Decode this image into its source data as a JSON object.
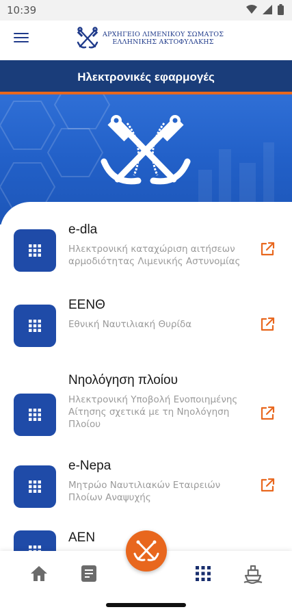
{
  "status_bar": {
    "time": "10:39",
    "icons": [
      "wifi-icon",
      "signal-icon",
      "battery-icon"
    ]
  },
  "header": {
    "menu_icon": "hamburger-menu-icon",
    "brand_line1": "ΑΡΧΗΓΕΙΟ ΛΙΜΕΝΙΚΟΥ ΣΩΜΑΤΟΣ",
    "brand_line2": "ΕΛΛΗΝΙΚΗΣ ΑΚΤΟΦΥΛΑΚΗΣ",
    "brand_logo": "crossed-anchors-logo"
  },
  "title": "Ηλεκτρονικές εφαρμογές",
  "colors": {
    "primary": "#1a3d7a",
    "accent": "#e8671e",
    "icon_tile": "#1f4ba8",
    "hero": "#2563c9"
  },
  "apps": [
    {
      "title": "e-dla",
      "description": "Ηλεκτρονική καταχώριση αιτήσεων αρμοδιότητας Λιμενικής Αστυνομίας",
      "icon": "apps-grid-icon",
      "link_icon": "external-link-icon"
    },
    {
      "title": "ΕΕΝΘ",
      "description": "Εθνική Ναυτιλιακή Θυρίδα",
      "icon": "apps-grid-icon",
      "link_icon": "external-link-icon"
    },
    {
      "title": "Νηολόγηση πλοίου",
      "description": "Ηλεκτρονική Υποβολή Ενοποιημένης Αίτησης σχετικά με τη Νηολόγηση Πλοίου",
      "icon": "apps-grid-icon",
      "link_icon": "external-link-icon"
    },
    {
      "title": "e-Nepa",
      "description": "Μητρώο Ναυτιλιακών Εταιρειών Πλοίων Αναψυχής",
      "icon": "apps-grid-icon",
      "link_icon": "external-link-icon"
    },
    {
      "title": "ΑΕΝ",
      "description": "",
      "icon": "apps-grid-icon",
      "link_icon": "external-link-icon"
    }
  ],
  "bottom_nav": {
    "items": [
      "home-icon",
      "document-icon",
      "anchor-fab-icon",
      "apps-grid-icon",
      "ship-icon"
    ],
    "active": "apps-grid-icon"
  }
}
